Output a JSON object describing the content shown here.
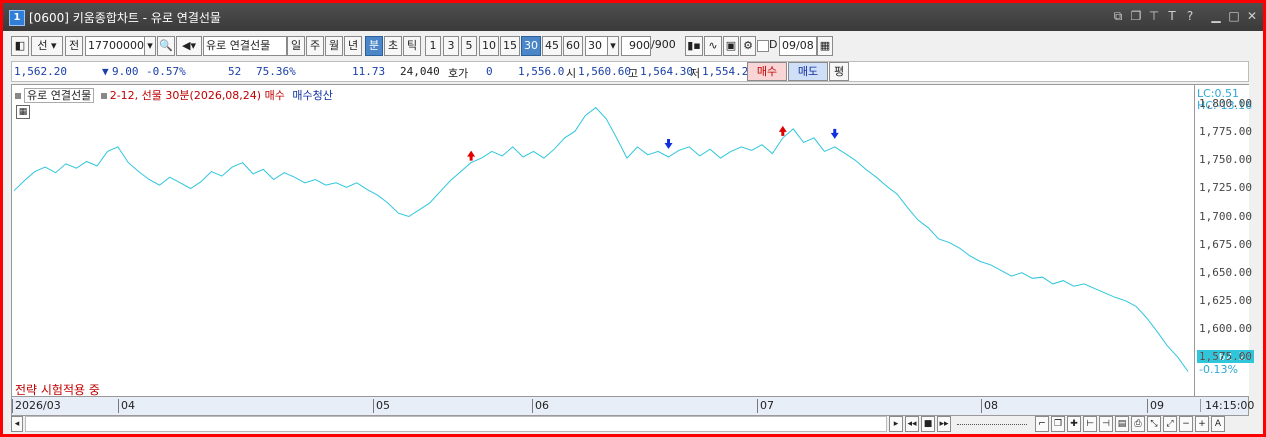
{
  "window": {
    "number_badge": "1",
    "title": "[0600] 키움종합차트 - 유로 연결선물",
    "buttons": [
      "⧉",
      "⧉",
      "T",
      "T",
      "?",
      "_",
      "□",
      "×"
    ]
  },
  "toolbar": {
    "market": "선",
    "all_label": "전",
    "code_value": "17700000",
    "instrument_name": "유로 연결선물",
    "period_buttons": [
      "일",
      "주",
      "월",
      "년",
      "분",
      "초",
      "틱"
    ],
    "active_period": "분",
    "interval_buttons": [
      "1",
      "3",
      "5",
      "10",
      "15",
      "30",
      "45",
      "60"
    ],
    "active_interval": "30",
    "interval_select": "30",
    "count_value": "900",
    "count_max": "/900",
    "date_checkbox_label": "D",
    "date_value": "09/08"
  },
  "quote": {
    "price": "1,562.20",
    "change_arrow": "▼",
    "change": "9.00",
    "change_pct": "-0.57%",
    "f1": "52",
    "f2": "75.36%",
    "f3": "11.73",
    "volume": "24,040",
    "quote_label": "호가",
    "f4": "0",
    "f5": "1,556.0",
    "open_label": "시",
    "open": "1,560.60",
    "high_label": "고",
    "high": "1,564.30",
    "low_label": "저",
    "low": "1,554.20",
    "buy_label": "매수",
    "sell_label": "매도",
    "eval_label": "평"
  },
  "chart": {
    "legend_name": "유로 연결선물",
    "legend_detail": "2-12, 선물 30분(2026,08,24) 매수",
    "legend_detail2": "매수청산",
    "lc_label": "LC:0.51",
    "hc_label": "HC:-13.16",
    "current_price_tag": "1,562.20",
    "current_pct_tag": "-0.13%",
    "strategy_text": "전략 시험적용 중",
    "time_label": "14:15:00",
    "colors": {
      "line": "#2fc6dc",
      "buy": "#e00000",
      "sell": "#1030e0",
      "price_tag_bg": "#2fc6dc"
    }
  },
  "chart_data": {
    "type": "line",
    "ylim": [
      1550,
      1810
    ],
    "ytick_labels": [
      "1,800.00",
      "1,775.00",
      "1,750.00",
      "1,725.00",
      "1,700.00",
      "1,675.00",
      "1,650.00",
      "1,625.00",
      "1,600.00",
      "1,575.00"
    ],
    "yticks": [
      1800,
      1775,
      1750,
      1725,
      1700,
      1675,
      1650,
      1625,
      1600,
      1575
    ],
    "xtick_labels": [
      "2026/03",
      "04",
      "05",
      "06",
      "07",
      "08",
      "09"
    ],
    "series": [
      {
        "values": [
          1723,
          1732,
          1740,
          1744,
          1739,
          1747,
          1743,
          1749,
          1745,
          1758,
          1762,
          1748,
          1740,
          1733,
          1728,
          1735,
          1730,
          1725,
          1731,
          1740,
          1736,
          1744,
          1748,
          1738,
          1742,
          1733,
          1739,
          1735,
          1730,
          1733,
          1728,
          1730,
          1726,
          1730,
          1724,
          1719,
          1712,
          1703,
          1700,
          1706,
          1712,
          1722,
          1732,
          1740,
          1748,
          1752,
          1758,
          1754,
          1762,
          1753,
          1758,
          1752,
          1760,
          1770,
          1776,
          1790,
          1797,
          1787,
          1770,
          1752,
          1762,
          1755,
          1758,
          1753,
          1759,
          1762,
          1754,
          1760,
          1752,
          1758,
          1762,
          1759,
          1764,
          1756,
          1770,
          1778,
          1766,
          1770,
          1758,
          1762,
          1756,
          1750,
          1742,
          1735,
          1727,
          1720,
          1708,
          1697,
          1690,
          1680,
          1677,
          1672,
          1665,
          1660,
          1657,
          1652,
          1647,
          1650,
          1645,
          1646,
          1640,
          1643,
          1638,
          1640,
          1636,
          1632,
          1628,
          1625,
          1620,
          1610,
          1598,
          1585,
          1575,
          1562
        ]
      }
    ],
    "markers": [
      {
        "index": 44,
        "type": "buy"
      },
      {
        "index": 63,
        "type": "sell"
      },
      {
        "index": 74,
        "type": "buy"
      },
      {
        "index": 79,
        "type": "sell"
      }
    ]
  }
}
